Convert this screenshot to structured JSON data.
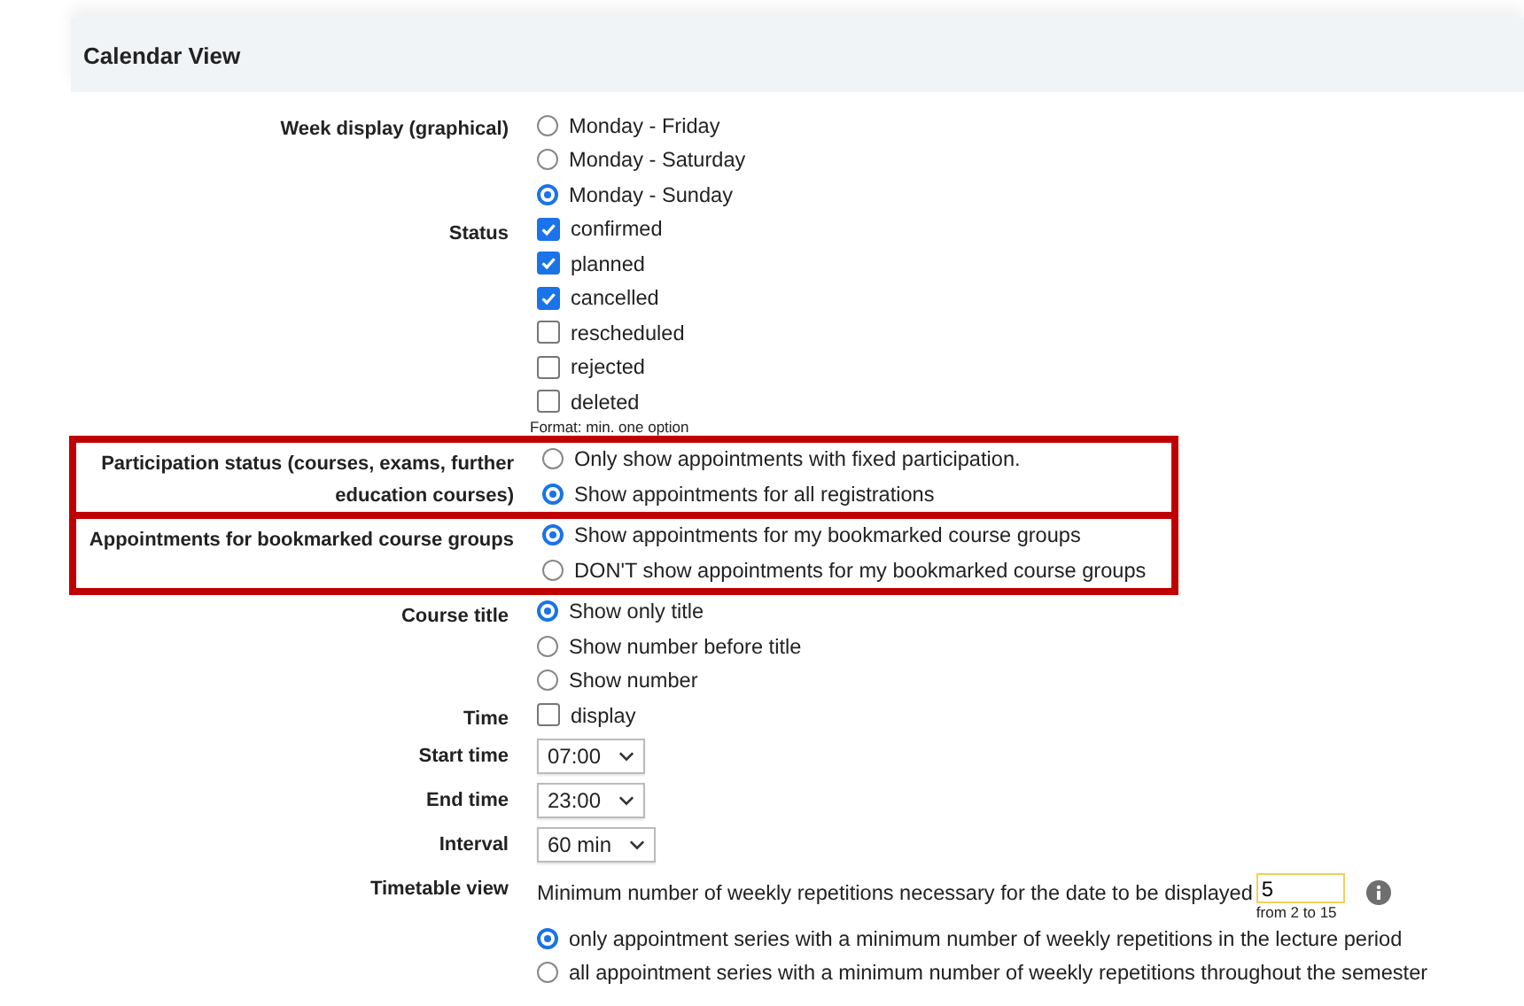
{
  "header": {
    "title": "Calendar View"
  },
  "fields": [
    {
      "kind": "radio",
      "label": "Week display (graphical)",
      "highlighted": false,
      "options": [
        {
          "label": "Monday - Friday",
          "selected": false
        },
        {
          "label": "Monday - Saturday",
          "selected": false
        },
        {
          "label": "Monday - Sunday",
          "selected": true
        }
      ]
    },
    {
      "kind": "checkbox",
      "label": "Status",
      "highlighted": false,
      "hint": "Format: min. one option",
      "options": [
        {
          "label": "confirmed",
          "checked": true
        },
        {
          "label": "planned",
          "checked": true
        },
        {
          "label": "cancelled",
          "checked": true
        },
        {
          "label": "rescheduled",
          "checked": false
        },
        {
          "label": "rejected",
          "checked": false
        },
        {
          "label": "deleted",
          "checked": false
        }
      ]
    },
    {
      "kind": "radio",
      "label": "Participation status (courses, exams, further education courses)",
      "highlighted": true,
      "options": [
        {
          "label": "Only show appointments with fixed participation.",
          "selected": false
        },
        {
          "label": "Show appointments for all registrations",
          "selected": true
        }
      ]
    },
    {
      "kind": "radio",
      "label": "Appointments for bookmarked course groups",
      "highlighted": true,
      "options": [
        {
          "label": "Show appointments for my bookmarked course groups",
          "selected": true
        },
        {
          "label": "DON'T show appointments for my bookmarked course groups",
          "selected": false
        }
      ]
    },
    {
      "kind": "radio",
      "label": "Course title",
      "highlighted": false,
      "options": [
        {
          "label": "Show only title",
          "selected": true
        },
        {
          "label": "Show number before title",
          "selected": false
        },
        {
          "label": "Show number",
          "selected": false
        }
      ]
    },
    {
      "kind": "checkbox",
      "label": "Time",
      "highlighted": false,
      "options": [
        {
          "label": "display",
          "checked": false
        }
      ]
    },
    {
      "kind": "select",
      "label": "Start time",
      "highlighted": false,
      "value": "07:00"
    },
    {
      "kind": "select",
      "label": "End time",
      "highlighted": false,
      "value": "23:00"
    },
    {
      "kind": "select",
      "label": "Interval",
      "highlighted": false,
      "value": "60 min"
    },
    {
      "kind": "timetable",
      "label": "Timetable view",
      "highlighted": false,
      "prompt": "Minimum number of weekly repetitions necessary for the date to be displayed",
      "input": {
        "value": "5",
        "hint": "from 2 to 15"
      },
      "options": [
        {
          "label": "only appointment series with a minimum number of weekly repetitions in the lecture period",
          "selected": true
        },
        {
          "label": "all appointment series with a minimum number of weekly repetitions throughout the semester",
          "selected": false
        }
      ]
    }
  ]
}
